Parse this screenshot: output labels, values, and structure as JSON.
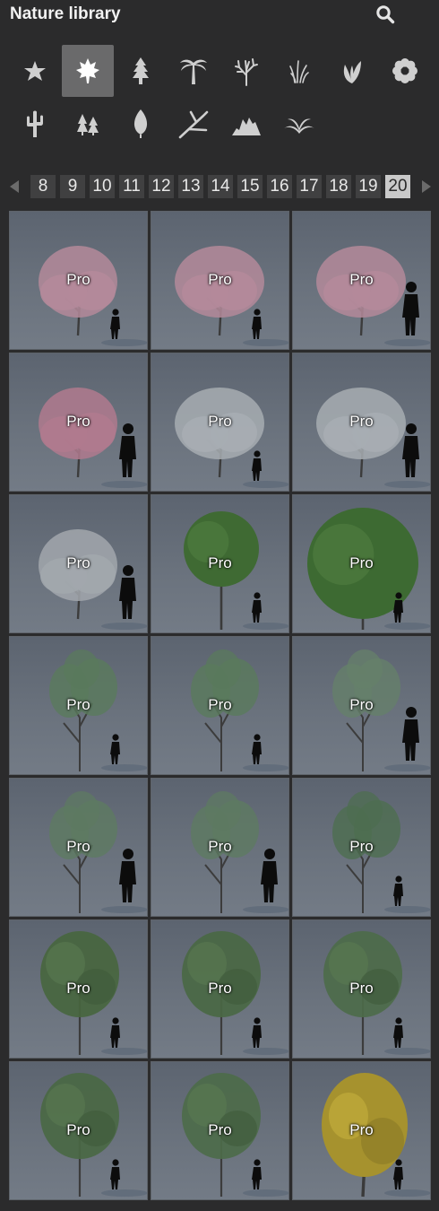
{
  "header": {
    "title": "Nature library",
    "search_icon": "search-icon"
  },
  "categories": [
    {
      "icon": "star-icon",
      "active": false
    },
    {
      "icon": "maple-leaf-icon",
      "active": true
    },
    {
      "icon": "pine-tree-icon",
      "active": false
    },
    {
      "icon": "palm-tree-icon",
      "active": false
    },
    {
      "icon": "bare-tree-icon",
      "active": false
    },
    {
      "icon": "grass-icon",
      "active": false
    },
    {
      "icon": "plant-icon",
      "active": false
    },
    {
      "icon": "flower-icon",
      "active": false
    },
    {
      "icon": "cactus-icon",
      "active": false
    },
    {
      "icon": "forest-icon",
      "active": false
    },
    {
      "icon": "leaf-icon",
      "active": false
    },
    {
      "icon": "branch-icon",
      "active": false
    },
    {
      "icon": "rocks-icon",
      "active": false
    },
    {
      "icon": "fern-icon",
      "active": false
    }
  ],
  "pagination": {
    "pages": [
      "8",
      "9",
      "10",
      "11",
      "12",
      "13",
      "14",
      "15",
      "16",
      "17",
      "18",
      "19",
      "20"
    ],
    "current": "20",
    "prev_icon": "chevron-left-icon",
    "next_icon": "chevron-right-icon"
  },
  "items": [
    {
      "badge": "Pro",
      "tree": "pink-blossom",
      "foliage": "#b48a9a",
      "person": "small"
    },
    {
      "badge": "Pro",
      "tree": "pink-blossom",
      "foliage": "#b48a9a",
      "person": "small"
    },
    {
      "badge": "Pro",
      "tree": "pink-blossom",
      "foliage": "#b48a9a",
      "person": "large"
    },
    {
      "badge": "Pro",
      "tree": "pink-blossom",
      "foliage": "#b07a8e",
      "person": "large"
    },
    {
      "badge": "Pro",
      "tree": "white-blossom",
      "foliage": "#a7adb2",
      "person": "small"
    },
    {
      "badge": "Pro",
      "tree": "white-blossom",
      "foliage": "#a7adb2",
      "person": "large"
    },
    {
      "badge": "Pro",
      "tree": "white-blossom",
      "foliage": "#a2a7ad",
      "person": "large"
    },
    {
      "badge": "Pro",
      "tree": "round-green",
      "foliage": "#3f6a33",
      "person": "small"
    },
    {
      "badge": "Pro",
      "tree": "round-green",
      "foliage": "#3d6a32",
      "person": "small"
    },
    {
      "badge": "Pro",
      "tree": "slender-green",
      "foliage": "#5a7a5c",
      "person": "small"
    },
    {
      "badge": "Pro",
      "tree": "slender-green",
      "foliage": "#5a7a5c",
      "person": "small"
    },
    {
      "badge": "Pro",
      "tree": "slender-green",
      "foliage": "#65806a",
      "person": "large"
    },
    {
      "badge": "Pro",
      "tree": "slender-green",
      "foliage": "#5e7a62",
      "person": "large"
    },
    {
      "badge": "Pro",
      "tree": "slender-green",
      "foliage": "#5e7a62",
      "person": "large"
    },
    {
      "badge": "Pro",
      "tree": "slender-green",
      "foliage": "#4e6e50",
      "person": "small"
    },
    {
      "badge": "Pro",
      "tree": "tall-green",
      "foliage": "#48663f",
      "person": "small"
    },
    {
      "badge": "Pro",
      "tree": "tall-green",
      "foliage": "#4a6844",
      "person": "small"
    },
    {
      "badge": "Pro",
      "tree": "tall-green",
      "foliage": "#4d6b4a",
      "person": "small"
    },
    {
      "badge": "Pro",
      "tree": "tall-green",
      "foliage": "#4a6844",
      "person": "small"
    },
    {
      "badge": "Pro",
      "tree": "tall-green",
      "foliage": "#4d6b4a",
      "person": "small"
    },
    {
      "badge": "Pro",
      "tree": "yellow-autumn",
      "foliage": "#a6922e",
      "person": "small"
    }
  ]
}
